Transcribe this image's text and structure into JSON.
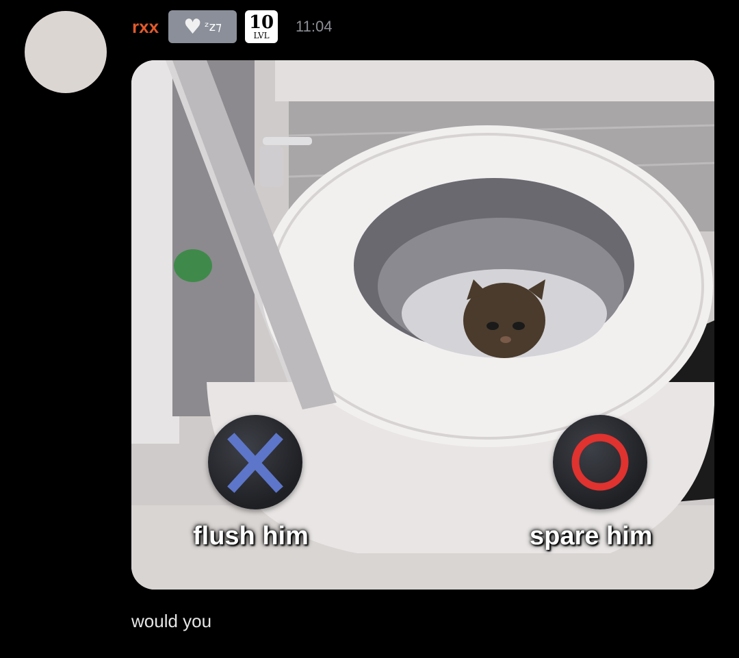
{
  "message": {
    "author": "rxx",
    "status_badge": {
      "icon": "heart-icon",
      "text": "ᶻz⁊"
    },
    "level_badge": {
      "number": "10",
      "label": "LVL"
    },
    "time": "11:04",
    "text": "would you",
    "image": {
      "left_choice": {
        "icon": "cross-icon",
        "label": "flush him",
        "color": "#5d76c9"
      },
      "right_choice": {
        "icon": "circle-icon",
        "label": "spare him",
        "color": "#e0322f"
      }
    }
  },
  "colors": {
    "background": "#000000",
    "username": "#e35a2b",
    "timestamp": "#8d9096"
  }
}
